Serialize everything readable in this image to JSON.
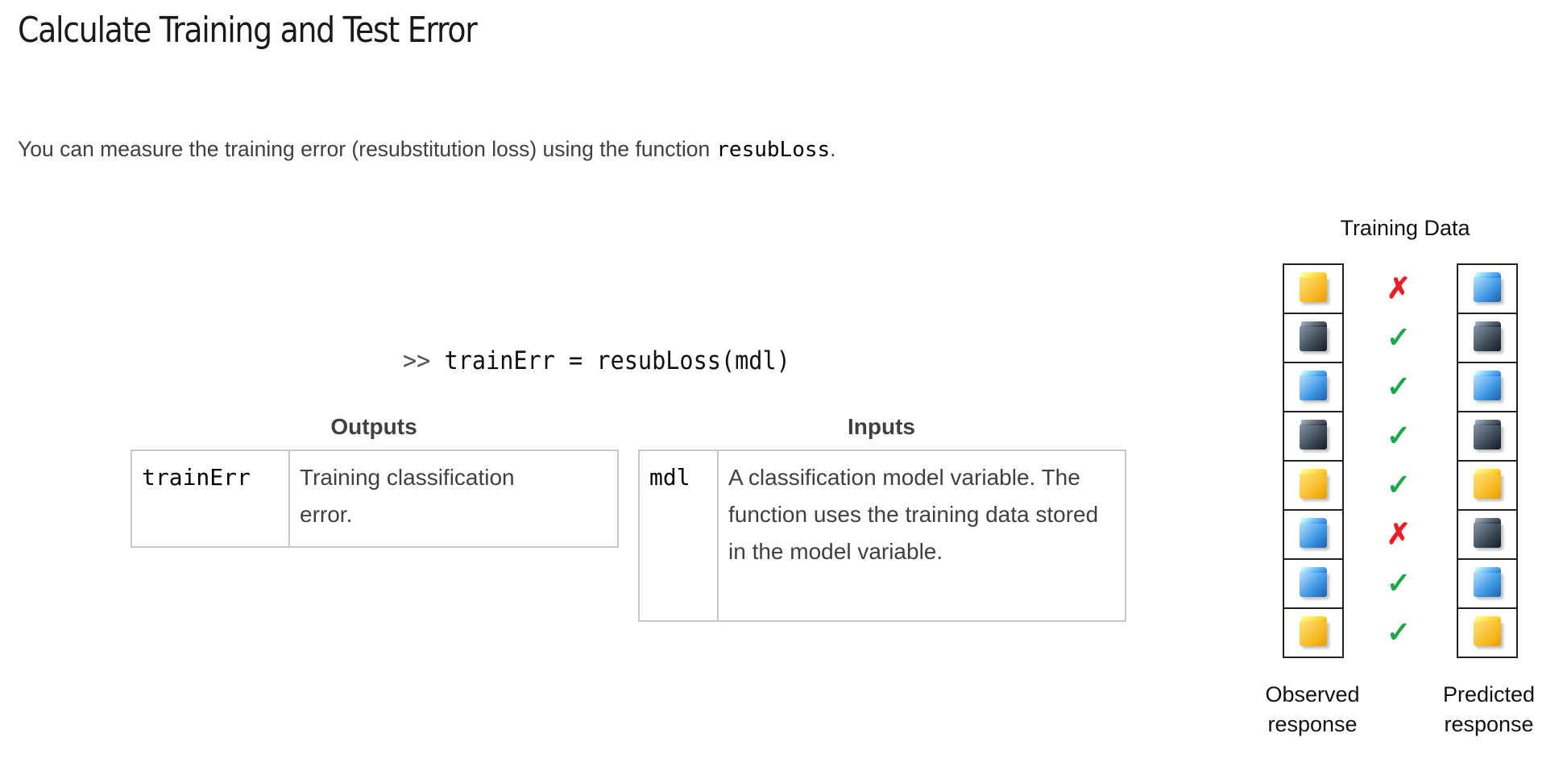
{
  "title": "Calculate Training and Test Error",
  "intro": {
    "text": "You can measure the training error (resubstitution loss) using the function",
    "function": "resubLoss",
    "end": "."
  },
  "command": {
    "prompt": ">>",
    "code": "trainErr = resubLoss(mdl)"
  },
  "outputs": {
    "heading": "Outputs",
    "name": "trainErr",
    "description": "Training classification error."
  },
  "inputs": {
    "heading": "Inputs",
    "name": "mdl",
    "description": "A classification model variable. The function uses the training data stored in the model variable."
  },
  "figure": {
    "title": "Training Data",
    "observed_label_1": "Observed",
    "observed_label_2": "response",
    "predicted_label_1": "Predicted",
    "predicted_label_2": "response",
    "colors": {
      "Y": "#f6b51c",
      "B": "#3d97e4",
      "D": "#3b4855",
      "wrong": "#ee1c24",
      "correct": "#1aa84a"
    },
    "observed": [
      "Y",
      "D",
      "B",
      "D",
      "Y",
      "B",
      "B",
      "Y"
    ],
    "predicted": [
      "B",
      "D",
      "B",
      "D",
      "Y",
      "D",
      "B",
      "Y"
    ],
    "match": [
      "x",
      "c",
      "c",
      "c",
      "c",
      "x",
      "c",
      "c"
    ]
  }
}
